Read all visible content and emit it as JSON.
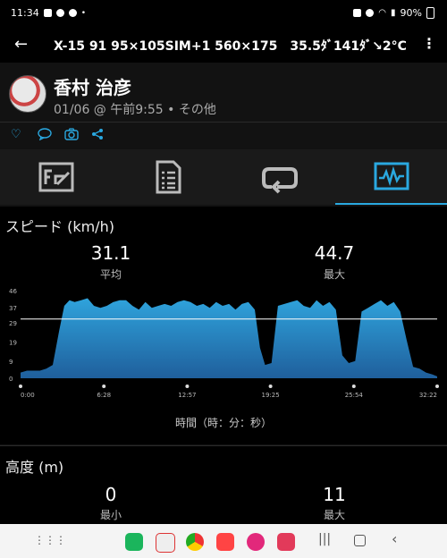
{
  "status": {
    "time": "11:34",
    "battery": "90%"
  },
  "header": {
    "title": "X-15 91 95×105SIM+1 560×175　35.5ﾀﾞ141ﾀﾞ↘2°C"
  },
  "activity": {
    "user": "香村 治彦",
    "meta": "01/06 @ 午前9:55 • その他"
  },
  "social": [
    "heart-icon",
    "comment-icon",
    "camera-icon",
    "share-icon"
  ],
  "tabs": [
    "overview-tab",
    "details-tab",
    "laps-tab",
    "graph-tab"
  ],
  "speed": {
    "title": "スピード (km/h)",
    "avg": "31.1",
    "avg_label": "平均",
    "max": "44.7",
    "max_label": "最大",
    "axis_caption": "時間（時：分：秒）"
  },
  "elevation": {
    "title": "高度 (m)",
    "min": "0",
    "min_label": "最小",
    "max": "11",
    "max_label": "最大"
  },
  "colors": {
    "accent": "#2aa8e0",
    "chart_top": "#2fa3dc",
    "chart_bottom": "#1f5f9c"
  },
  "chart_data": {
    "type": "area",
    "yticks": [
      "0",
      "9",
      "19",
      "29",
      "37",
      "46"
    ],
    "xticks": [
      "0:00",
      "6:28",
      "12:57",
      "19:25",
      "25:54",
      "32:22"
    ],
    "ylim": [
      0,
      46
    ],
    "avg_line": 31.1,
    "x": [
      0.0,
      0.5,
      1.0,
      1.5,
      2.0,
      2.5,
      3.0,
      3.4,
      3.8,
      4.2,
      4.7,
      5.2,
      5.7,
      6.2,
      6.7,
      7.2,
      7.7,
      8.2,
      8.7,
      9.2,
      9.7,
      10.2,
      10.7,
      11.2,
      11.7,
      12.2,
      12.7,
      13.2,
      13.7,
      14.2,
      14.7,
      15.2,
      15.7,
      16.2,
      16.7,
      17.2,
      17.7,
      18.2,
      18.6,
      19.0,
      19.5,
      20.0,
      20.5,
      21.0,
      21.5,
      22.0,
      22.5,
      23.0,
      23.5,
      24.0,
      24.5,
      25.0,
      25.5,
      26.0,
      26.5,
      27.0,
      27.5,
      28.0,
      28.5,
      29.0,
      29.5,
      30.0,
      30.5,
      31.0,
      31.5,
      32.0,
      32.37
    ],
    "y": [
      3,
      4,
      4,
      4,
      5,
      7,
      25,
      38,
      41,
      40,
      41,
      42,
      38,
      37,
      38,
      40,
      41,
      41,
      38,
      36,
      40,
      37,
      38,
      39,
      38,
      40,
      41,
      40,
      38,
      39,
      37,
      40,
      38,
      39,
      36,
      39,
      40,
      36,
      16,
      7,
      8,
      38,
      39,
      40,
      41,
      38,
      37,
      41,
      38,
      40,
      36,
      12,
      8,
      9,
      35,
      37,
      39,
      41,
      38,
      40,
      35,
      20,
      6,
      5,
      3,
      2,
      1
    ]
  }
}
